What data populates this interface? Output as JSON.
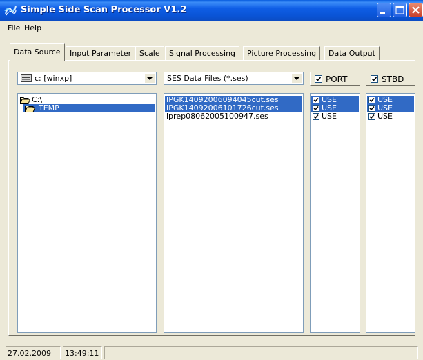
{
  "window": {
    "title": "Simple Side Scan Processor V1.2"
  },
  "menu": {
    "file": "File",
    "help": "Help"
  },
  "tabs": [
    {
      "label": "Data Source"
    },
    {
      "label": "Input Parameter"
    },
    {
      "label": "Scale"
    },
    {
      "label": "Signal Processing"
    },
    {
      "label": "Picture Processing"
    },
    {
      "label": "Data Output"
    }
  ],
  "drive_select": {
    "value": "c: [winxp]"
  },
  "filter_select": {
    "value": "SES Data Files (*.ses)"
  },
  "port": {
    "label": "PORT",
    "checked": true
  },
  "stbd": {
    "label": "STBD",
    "checked": true
  },
  "folders": [
    {
      "label": "C:\\"
    },
    {
      "label": "TEMP"
    }
  ],
  "files": [
    {
      "name": "IPGK14092006094045cut.ses"
    },
    {
      "name": "IPGK14092006101726cut.ses"
    },
    {
      "name": "iprep08062005100947.ses"
    }
  ],
  "port_use": [
    {
      "label": "USE"
    },
    {
      "label": "USE"
    },
    {
      "label": "USE"
    }
  ],
  "stbd_use": [
    {
      "label": "USE"
    },
    {
      "label": "USE"
    },
    {
      "label": "USE"
    }
  ],
  "status": {
    "date": "27.02.2009",
    "time": "13:49:11"
  },
  "colors": {
    "titlebar": "#0a54d6",
    "selection": "#316ac5",
    "face": "#ece9d8"
  }
}
